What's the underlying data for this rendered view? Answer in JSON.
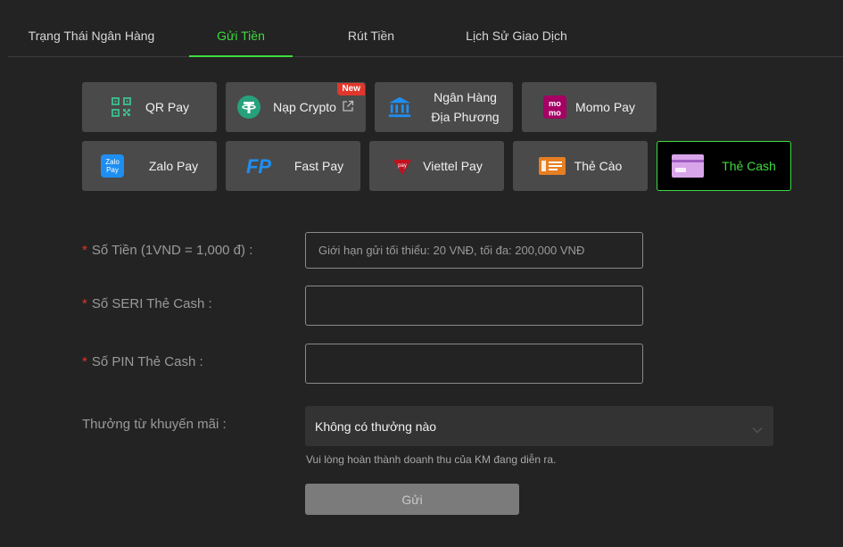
{
  "tabs": [
    {
      "label": "Trạng Thái Ngân Hàng"
    },
    {
      "label": "Gửi Tiền"
    },
    {
      "label": "Rút Tiền"
    },
    {
      "label": "Lịch Sử Giao Dịch"
    }
  ],
  "methods": {
    "qr": {
      "label": "QR Pay",
      "icon": "qr-code-icon"
    },
    "crypto": {
      "label": "Nạp Crypto",
      "icon": "tether-icon",
      "badge": "New"
    },
    "bank_line1": "Ngân Hàng",
    "bank_line2": "Địa Phương",
    "bank_icon": "bank-icon",
    "momo": {
      "label": "Momo Pay",
      "icon": "momo-icon",
      "logo_text_top": "mo",
      "logo_text_bottom": "mo"
    },
    "zalo": {
      "label": "Zalo Pay",
      "icon": "zalo-icon",
      "logo_text_top": "Zalo",
      "logo_text_bottom": "Pay"
    },
    "fast": {
      "label": "Fast Pay",
      "icon": "fastpay-icon",
      "logo_text": "FP"
    },
    "viettel": {
      "label": "Viettel Pay",
      "icon": "viettel-icon",
      "logo_text": "pay"
    },
    "thecao": {
      "label": "Thẻ Cào",
      "icon": "scratch-card-icon"
    },
    "thecash": {
      "label": "Thẻ Cash",
      "icon": "card-icon"
    }
  },
  "form": {
    "amount_label": "Số Tiền (1VND = 1,000 đ) :",
    "amount_placeholder": "Giới hạn gửi tối thiểu: 20 VNĐ, tối đa: 200,000 VNĐ",
    "serial_label": "Số SERI Thẻ Cash :",
    "pin_label": "Số PIN Thẻ Cash :",
    "required_mark": "*",
    "promo_label": "Thưởng từ khuyến mãi :",
    "promo_value": "Không có thưởng nào",
    "promo_hint": "Vui lòng hoàn thành doanh thu của KM đang diễn ra.",
    "submit_label": "Gửi"
  },
  "colors": {
    "accent": "#3ddc3d",
    "background": "#232323",
    "button_bg": "#4a4a4a",
    "required": "#e0362c"
  }
}
